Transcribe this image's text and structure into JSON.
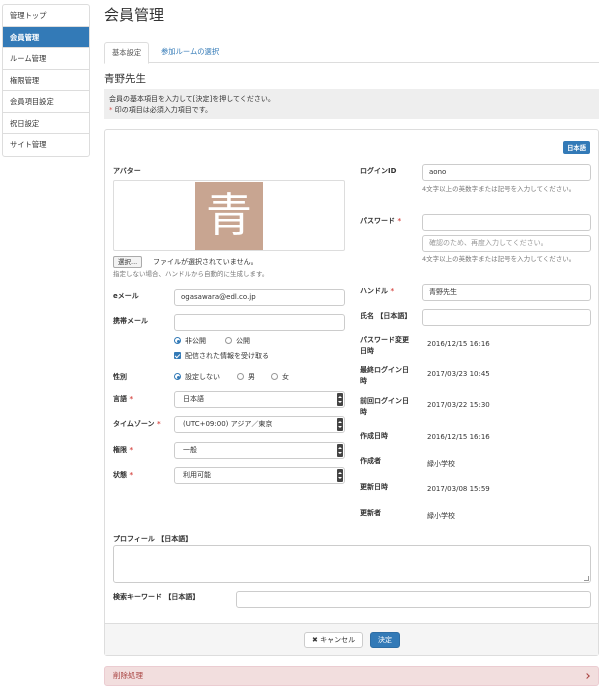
{
  "sidebar": {
    "items": [
      {
        "label": "管理トップ"
      },
      {
        "label": "会員管理"
      },
      {
        "label": "ルーム管理"
      },
      {
        "label": "権限管理"
      },
      {
        "label": "会員項目設定"
      },
      {
        "label": "祝日設定"
      },
      {
        "label": "サイト管理"
      }
    ]
  },
  "page": {
    "title": "会員管理",
    "user_name": "青野先生"
  },
  "tabs": [
    {
      "label": "基本設定"
    },
    {
      "label": "参加ルームの選択"
    }
  ],
  "notice": {
    "line1": "会員の基本項目を入力して[決定]を押してください。",
    "req_mark": "*",
    "line2": " 印の項目は必須入力項目です。"
  },
  "form": {
    "lang_badge": "日本語",
    "req_mark": "*",
    "avatar": {
      "label": "アバター",
      "glyph": "青",
      "select_button": "選択...",
      "file_status": "ファイルが選択されていません。",
      "hint": "指定しない場合、ハンドルから自動的に生成します。"
    },
    "email": {
      "label": "eメール",
      "value": "ogasawara@edl.co.jp"
    },
    "mobile": {
      "label": "携帯メール",
      "value": ""
    },
    "visibility": {
      "private": "非公開",
      "public": "公開"
    },
    "receive": {
      "label": "配信された情報を受け取る"
    },
    "gender": {
      "label": "性別",
      "options": [
        "設定しない",
        "男",
        "女"
      ]
    },
    "language": {
      "label": "言語",
      "value": "日本語"
    },
    "timezone": {
      "label": "タイムゾーン",
      "value": "(UTC+09:00) アジア／東京"
    },
    "role": {
      "label": "権限",
      "value": "一般"
    },
    "status": {
      "label": "状態",
      "value": "利用可能"
    },
    "login_id": {
      "label": "ログインID",
      "value": "aono",
      "hint": "4文字以上の英数字または記号を入力してください。"
    },
    "password": {
      "label": "パスワード",
      "value": "",
      "confirm_placeholder": "確認のため、再度入力してください。",
      "hint": "4文字以上の英数字または記号を入力してください。"
    },
    "handle": {
      "label": "ハンドル",
      "value": "青野先生"
    },
    "full_name": {
      "label": "氏名 【日本語】",
      "value": ""
    },
    "password_changed": {
      "label1": "パスワード変更",
      "label2": "日時",
      "value": "2016/12/15 16:16"
    },
    "last_login": {
      "label1": "最終ログイン日",
      "label2": "時",
      "value": "2017/03/23 10:45"
    },
    "prev_login": {
      "label1": "前回ログイン日",
      "label2": "時",
      "value": "2017/03/22 15:30"
    },
    "created": {
      "label": "作成日時",
      "value": "2016/12/15 16:16"
    },
    "creator": {
      "label": "作成者",
      "value": "緑小学校"
    },
    "modified": {
      "label": "更新日時",
      "value": "2017/03/08 15:59"
    },
    "modifier": {
      "label": "更新者",
      "value": "緑小学校"
    },
    "profile": {
      "label": "プロフィール 【日本語】"
    },
    "search_keyword": {
      "label": "検索キーワード 【日本語】"
    },
    "cancel_button": "キャンセル",
    "submit_button": "決定"
  },
  "danger": {
    "title": "削除処理"
  },
  "colors": {
    "primary": "#337ab7",
    "danger_bg": "#f2dede",
    "danger_text": "#a94442",
    "required": "#d9534f"
  }
}
